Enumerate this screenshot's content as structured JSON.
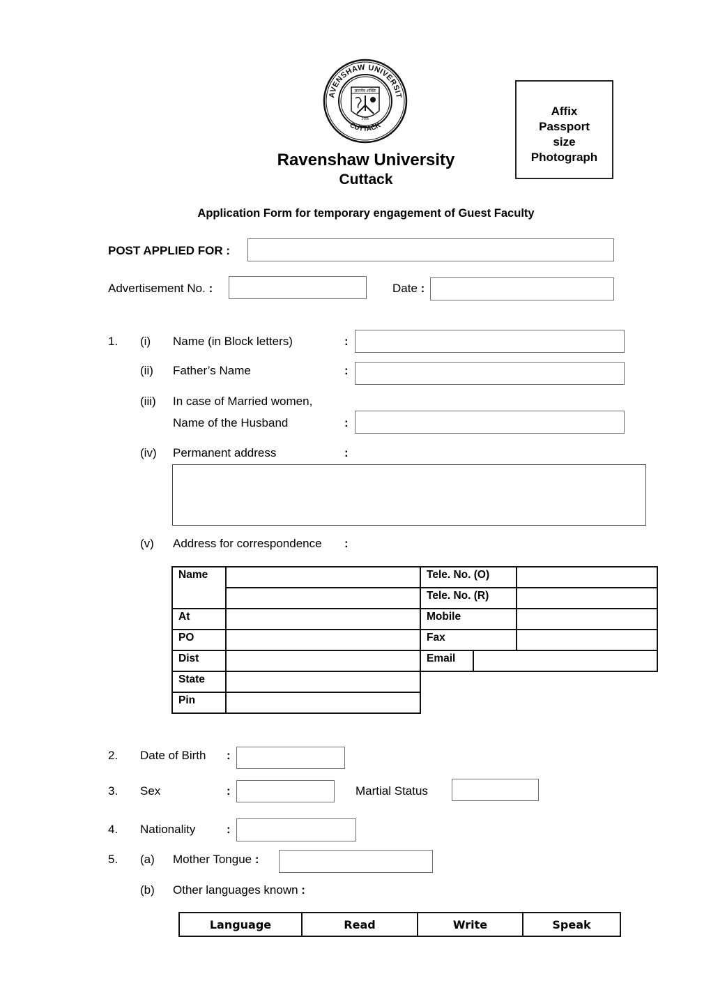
{
  "header": {
    "logo": {
      "icon": "university-seal-icon",
      "top_text": "RAVENSHAW UNIVERSITY",
      "bottom_text": "CUTTACK",
      "year": "2006"
    },
    "photo_box_lines": [
      "Affix",
      "Passport",
      "size",
      "Photograph"
    ],
    "university_name": "Ravenshaw University",
    "city": "Cuttack",
    "form_title": "Application Form for temporary engagement of Guest Faculty"
  },
  "post_applied": {
    "label": "POST APPLIED FOR :",
    "value": ""
  },
  "advertisement": {
    "label": "Advertisement No. ",
    "colon": ":",
    "value": ""
  },
  "date": {
    "label": "Date ",
    "colon": ":",
    "value": ""
  },
  "section1": {
    "number": "1.",
    "items": [
      {
        "roman": "(i)",
        "label": "Name (in Block letters)",
        "colon": ":",
        "value": ""
      },
      {
        "roman": "(ii)",
        "label": "Father’s Name",
        "colon": ":",
        "value": ""
      },
      {
        "roman": "(iii)",
        "label_line1": "In case of Married women,",
        "label": "Name of the Husband",
        "colon": ":",
        "value": ""
      },
      {
        "roman": "(iv)",
        "label": "Permanent address",
        "colon": ":",
        "value": ""
      },
      {
        "roman": "(v)",
        "label": "Address for correspondence",
        "colon": ":"
      }
    ]
  },
  "correspondence": {
    "left_labels": [
      "Name",
      "At",
      "PO",
      "Dist",
      "State",
      "Pin"
    ],
    "right_labels": [
      "Tele. No. (O)",
      "Tele. No. (R)",
      "Mobile",
      "Fax",
      "Email"
    ]
  },
  "section2": {
    "number": "2.",
    "label": "Date of Birth",
    "colon": ":",
    "value": ""
  },
  "section3": {
    "number": "3.",
    "label": "Sex",
    "colon": ":",
    "value": "",
    "marital_label": "Martial Status",
    "marital_value": ""
  },
  "section4": {
    "number": "4.",
    "label": "Nationality",
    "colon": ":",
    "value": ""
  },
  "section5": {
    "number": "5.",
    "a": {
      "letter": "(a)",
      "label": "Mother Tongue ",
      "colon": ":",
      "value": ""
    },
    "b": {
      "letter": "(b)",
      "label": "Other languages known ",
      "colon": ":"
    },
    "table_headers": [
      "Language",
      "Read",
      "Write",
      "Speak"
    ]
  }
}
